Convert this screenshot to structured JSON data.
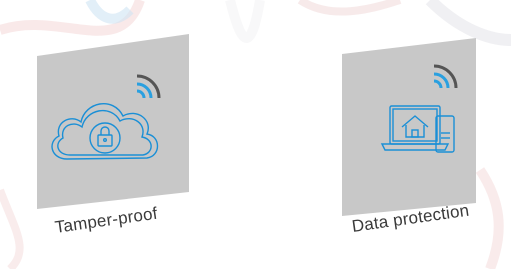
{
  "features": [
    {
      "label": "Tamper-proof",
      "icon": "cloud-lock-icon",
      "signal_icon": "wifi-signal-icon"
    },
    {
      "label": "Data protection",
      "icon": "laptop-phone-home-icon",
      "signal_icon": "wifi-signal-icon"
    }
  ],
  "colors": {
    "panel": "#c8c8c8",
    "icon_blue": "#1a8fd6",
    "signal_gray": "#555555",
    "signal_blue": "#2aa0e0",
    "background": "#ffffff"
  }
}
